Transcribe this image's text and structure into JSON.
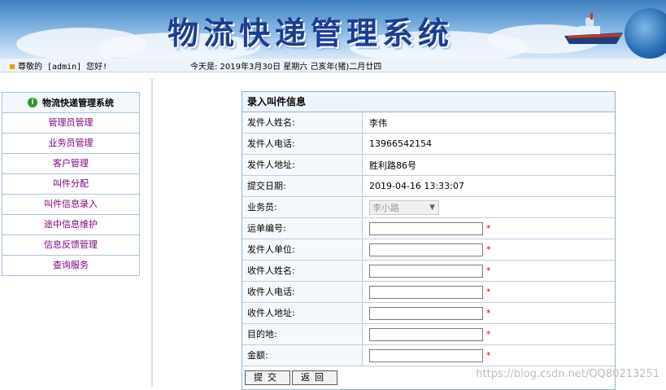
{
  "header": {
    "title": "物流快递管理系统",
    "greeting": "尊敬的 [admin] 您好!",
    "today": "今天是:  2019年3月30日 星期六 己亥年(猪)二月廿四"
  },
  "sidebar": {
    "title": "物流快递管理系统",
    "items": [
      {
        "label": "管理员管理"
      },
      {
        "label": "业务员管理"
      },
      {
        "label": "客户管理"
      },
      {
        "label": "叫件分配"
      },
      {
        "label": "叫件信息录入"
      },
      {
        "label": "途中信息维护"
      },
      {
        "label": "信息反馈管理"
      },
      {
        "label": "查询服务"
      }
    ]
  },
  "form": {
    "title": "录入叫件信息",
    "sender_name": {
      "label": "发件人姓名:",
      "value": "李伟"
    },
    "sender_phone": {
      "label": "发件人电话:",
      "value": "13966542154"
    },
    "sender_address": {
      "label": "发件人地址:",
      "value": "胜利路86号"
    },
    "submit_date": {
      "label": "提交日期:",
      "value": "2019-04-16 13:33:07"
    },
    "salesman": {
      "label": "业务员:",
      "value": "李小路"
    },
    "waybill_no": {
      "label": "运单编号:",
      "value": ""
    },
    "sender_company": {
      "label": "发件人单位:",
      "value": ""
    },
    "receiver_name": {
      "label": "收件人姓名:",
      "value": ""
    },
    "receiver_phone": {
      "label": "收件人电话:",
      "value": ""
    },
    "receiver_address": {
      "label": "收件人地址:",
      "value": ""
    },
    "destination": {
      "label": "目的地:",
      "value": ""
    },
    "amount": {
      "label": "金额:",
      "value": ""
    },
    "required_mark": "*",
    "submit_label": "提交",
    "back_label": "返回"
  },
  "watermark": "https://blog.csdn.net/QQ80213251",
  "colors": {
    "sidebar_link": "#800080",
    "required": "#e00000",
    "border": "#8fb3d8"
  }
}
